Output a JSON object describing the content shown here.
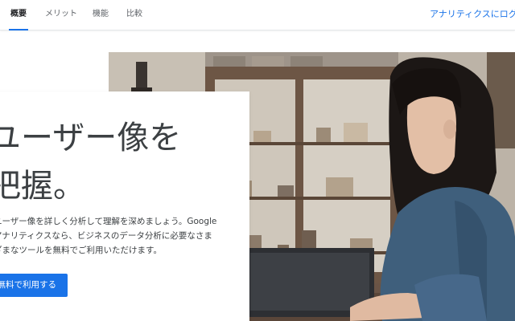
{
  "nav": {
    "tabs": [
      {
        "label": "概要",
        "active": true
      },
      {
        "label": "メリット",
        "active": false
      },
      {
        "label": "機能",
        "active": false
      },
      {
        "label": "比較",
        "active": false
      }
    ],
    "signin_label": "アナリティクスにログ"
  },
  "hero": {
    "headline": "ユーザー像を\n把握。",
    "description": "ユーザー像を詳しく分析して理解を深めましょう。Google\nアナリティクスなら、ビジネスのデータ分析に必要なさま\nざまなツールを無料でご利用いただけます。",
    "cta_label": "無料で利用する"
  },
  "colors": {
    "accent": "#1a73e8",
    "text": "#3c4043",
    "nav_text": "#5f6368"
  }
}
